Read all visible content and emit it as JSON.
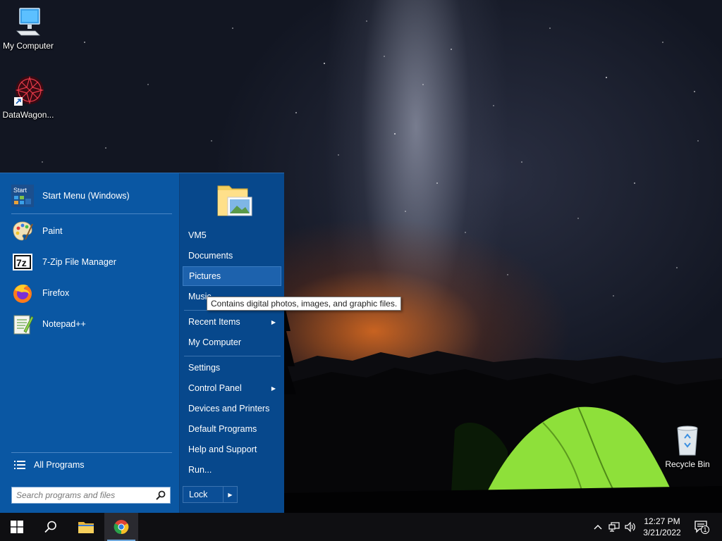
{
  "desktop": {
    "icons": [
      {
        "label": "My Computer",
        "icon": "monitor-icon"
      },
      {
        "label": "DataWagon...",
        "icon": "datawagon-shortcut-icon"
      },
      {
        "label": "Recycle Bin",
        "icon": "recycle-bin-icon"
      }
    ]
  },
  "start_menu": {
    "pinned": [
      {
        "label": "Start Menu (Windows)",
        "icon": "start-menu-icon",
        "icon_text": "Start"
      },
      {
        "label": "Paint",
        "icon": "paint-palette-icon"
      },
      {
        "label": "7-Zip File Manager",
        "icon": "7zip-icon",
        "icon_text": "7z"
      },
      {
        "label": "Firefox",
        "icon": "firefox-icon"
      },
      {
        "label": "Notepad++",
        "icon": "notepadpp-icon"
      }
    ],
    "all_programs": "All Programs",
    "search": {
      "placeholder": "Search programs and files",
      "value": ""
    },
    "right": [
      {
        "label": "VM5"
      },
      {
        "label": "Documents"
      },
      {
        "label": "Pictures",
        "state": "hover"
      },
      {
        "label": "Music"
      },
      {
        "label": "Recent Items",
        "submenu": true
      },
      {
        "label": "My Computer"
      },
      {
        "label": "Settings"
      },
      {
        "label": "Control Panel",
        "submenu": true
      },
      {
        "label": "Devices and Printers"
      },
      {
        "label": "Default Programs"
      },
      {
        "label": "Help and Support"
      },
      {
        "label": "Run..."
      }
    ],
    "lock": "Lock"
  },
  "tooltip": "Contains digital photos, images, and graphic files.",
  "taskbar": {
    "buttons": [
      {
        "name": "start-button",
        "icon": "windows-logo-icon"
      },
      {
        "name": "search-button",
        "icon": "search-icon"
      },
      {
        "name": "file-explorer-button",
        "icon": "folder-icon"
      },
      {
        "name": "chrome-button",
        "icon": "chrome-icon",
        "active": true
      }
    ],
    "clock": {
      "time": "12:27 PM",
      "date": "3/21/2022"
    },
    "notifications_count": "1"
  },
  "colors": {
    "start_left": "#0a57a3",
    "start_right": "#07488c",
    "taskbar": "#0f0f12",
    "tent": "#8ee03a"
  }
}
